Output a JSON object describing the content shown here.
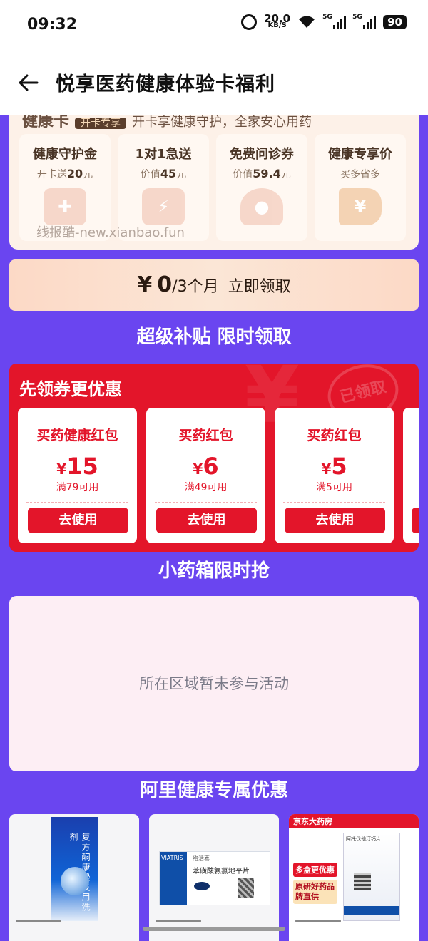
{
  "status_bar": {
    "time": "09:32",
    "net_speed": "20.0",
    "net_unit": "KB/S",
    "sig1": "5G",
    "sig2": "5G",
    "battery": "90"
  },
  "header": {
    "title": "悦享医药健康体验卡福利"
  },
  "card": {
    "cut_text": "健康卡",
    "cut_tag": "开卡专享",
    "cut_desc": "开卡享健康守护，全家安心用药",
    "benefits": [
      {
        "title": "健康守护金",
        "sub_pre": "开卡送",
        "sub_val": "20",
        "sub_post": "元",
        "icon": "medicine-box-icon"
      },
      {
        "title": "1对1急送",
        "sub_pre": "价值",
        "sub_val": "45",
        "sub_post": "元",
        "icon": "delivery-truck-icon"
      },
      {
        "title": "免费问诊券",
        "sub_pre": "价值",
        "sub_val": "59.4",
        "sub_post": "元",
        "icon": "doctor-icon"
      },
      {
        "title": "健康专享价",
        "sub_pre": "买多省多",
        "sub_val": "",
        "sub_post": "",
        "icon": "price-tag-icon"
      }
    ],
    "watermark": "线报酷-new.xianbao.fun"
  },
  "claim": {
    "currency": "¥",
    "amount": "0",
    "period": "/3个月",
    "action": "立即领取"
  },
  "section1": {
    "title": "超级补贴 限时领取"
  },
  "coupon_box": {
    "title": "先领券更优惠",
    "stamp": "已领取",
    "coupons": [
      {
        "name": "买药健康红包",
        "yen": "¥",
        "value": "15",
        "cond": "满79可用",
        "button": "去使用"
      },
      {
        "name": "买药红包",
        "yen": "¥",
        "value": "6",
        "cond": "满49可用",
        "button": "去使用"
      },
      {
        "name": "买药红包",
        "yen": "¥",
        "value": "5",
        "cond": "满5可用",
        "button": "去使用"
      }
    ]
  },
  "section2": {
    "title": "小药箱限时抢",
    "empty_text": "所在区域暂未参与活动"
  },
  "section3": {
    "title": "阿里健康专属优惠"
  },
  "products": [
    {
      "box_text": "复方酮康唑发用洗剂"
    },
    {
      "brand": "络活喜",
      "name": "苯磺酸氨氯地平片",
      "maker": "VIATRIS"
    },
    {
      "store": "京东大药房",
      "badge1": "多盒更优惠",
      "badge2": "原研好药品牌直供",
      "box_text": "阿托伐他汀钙片"
    }
  ],
  "colors": {
    "background": "#6a45f0",
    "coupon_red": "#e3152a",
    "card_bg": "#fdf1e8"
  }
}
